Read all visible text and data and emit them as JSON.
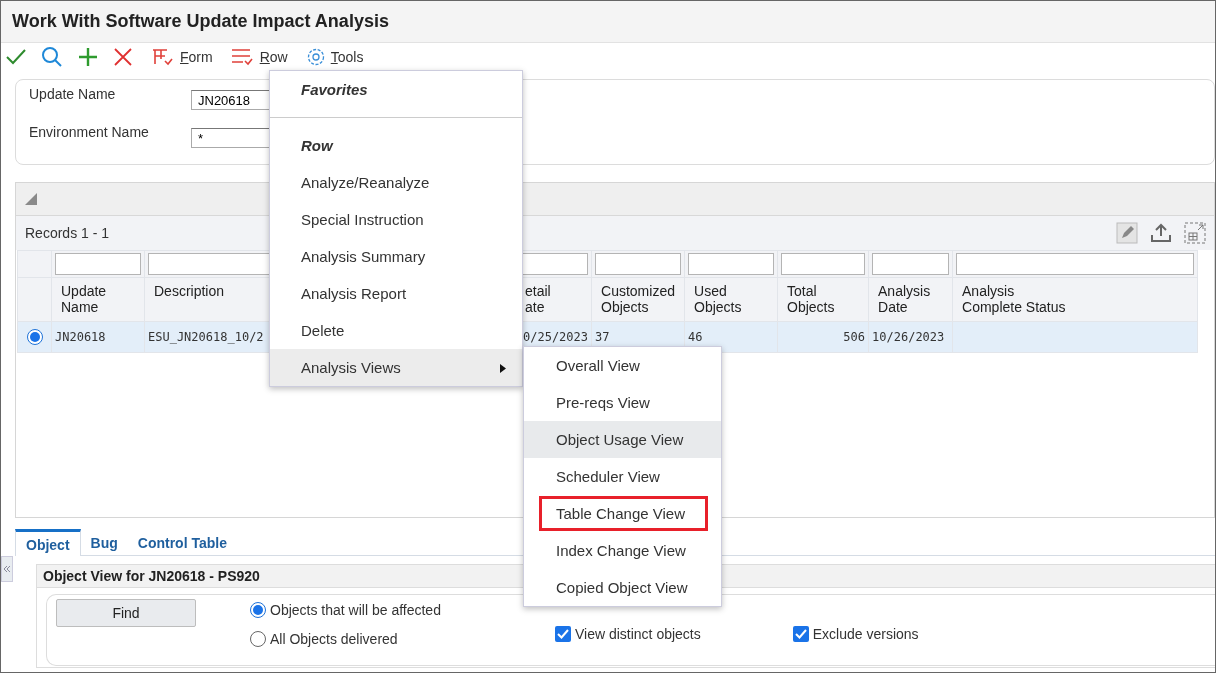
{
  "window": {
    "title": "Work With Software Update Impact Analysis"
  },
  "toolbar": {
    "menus": [
      {
        "label": "Form",
        "kind": "form"
      },
      {
        "label": "Row",
        "kind": "row"
      },
      {
        "label": "Tools",
        "kind": "tools"
      }
    ]
  },
  "search_fields": [
    {
      "label": "Update Name",
      "value": "JN20618"
    },
    {
      "label": "Environment Name",
      "value": "*"
    }
  ],
  "grid": {
    "records": "Records 1 - 1",
    "columns": [
      {
        "lines": [
          "Update",
          "Name"
        ]
      },
      {
        "lines": [
          "Description"
        ]
      },
      {
        "lines": [
          "etail",
          "ate"
        ]
      },
      {
        "lines": [
          "Customized",
          "Objects"
        ]
      },
      {
        "lines": [
          "Used",
          "Objects"
        ]
      },
      {
        "lines": [
          "Total",
          "Objects"
        ]
      },
      {
        "lines": [
          "Analysis",
          "Date"
        ]
      },
      {
        "lines": [
          "Analysis",
          "Complete Status"
        ]
      }
    ],
    "rows": [
      {
        "selected": true,
        "cells": [
          "JN20618",
          "ESU_JN20618_10/2",
          "0/25/2023",
          "37",
          "46",
          "506",
          "10/26/2023"
        ]
      }
    ]
  },
  "tabs": [
    {
      "label": "Object",
      "selected": true
    },
    {
      "label": "Bug",
      "selected": false
    },
    {
      "label": "Control Table",
      "selected": false
    }
  ],
  "panel": {
    "title": "Object View for JN20618 - PS920",
    "find_button": "Find",
    "radios": [
      {
        "label": "Objects that will be affected",
        "selected": true
      },
      {
        "label": "All Objects delivered",
        "selected": false
      }
    ],
    "checkboxes": [
      {
        "label": "View distinct objects",
        "checked": true
      },
      {
        "label": "Exclude versions",
        "checked": true
      }
    ]
  },
  "row_menu": {
    "items": [
      {
        "kind": "heading",
        "label": "Favorites"
      },
      {
        "kind": "separator"
      },
      {
        "kind": "heading",
        "label": "Row"
      },
      {
        "kind": "item",
        "label": "Analyze/Reanalyze"
      },
      {
        "kind": "item",
        "label": "Special Instruction"
      },
      {
        "kind": "item",
        "label": "Analysis Summary"
      },
      {
        "kind": "item",
        "label": "Analysis Report"
      },
      {
        "kind": "item",
        "label": "Delete"
      },
      {
        "kind": "submenu",
        "label": "Analysis Views",
        "expanded": true
      }
    ]
  },
  "submenu": {
    "items": [
      {
        "label": "Overall View",
        "hovered": false,
        "outlined": false
      },
      {
        "label": "Pre-reqs View",
        "hovered": false,
        "outlined": false
      },
      {
        "label": "Object Usage View",
        "hovered": true,
        "outlined": false
      },
      {
        "label": "Scheduler View",
        "hovered": false,
        "outlined": false
      },
      {
        "label": "Table Change View",
        "hovered": false,
        "outlined": true
      },
      {
        "label": "Index Change View",
        "hovered": false,
        "outlined": false
      },
      {
        "label": "Copied Object View",
        "hovered": false,
        "outlined": false
      }
    ]
  }
}
